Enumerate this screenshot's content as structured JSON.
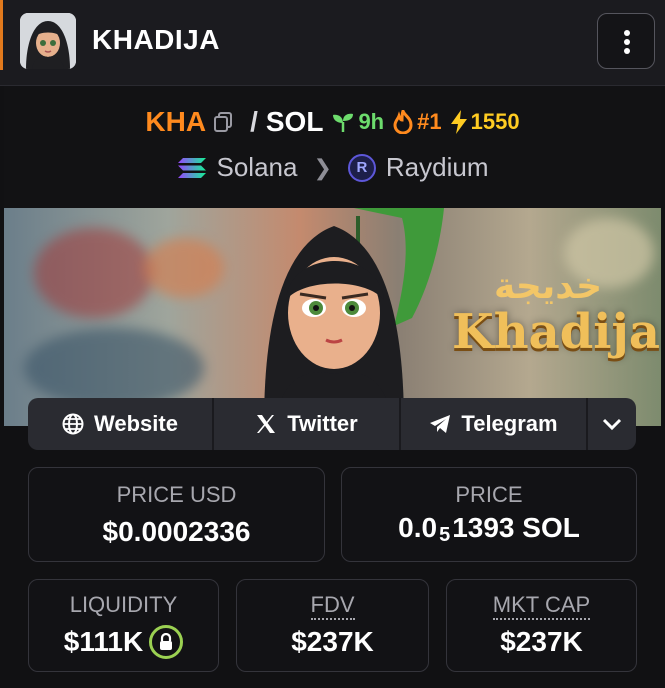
{
  "header": {
    "token_name": "KHADIJA"
  },
  "pair": {
    "base_symbol": "KHA",
    "separator": "/",
    "quote_symbol": "SOL",
    "age": "9h",
    "rank": "#1",
    "boosts": "1550",
    "chain": "Solana",
    "dex": "Raydium",
    "dex_icon_letter": "R"
  },
  "banner": {
    "arabic_text": "خديجة",
    "title": "Khadija"
  },
  "links": {
    "website": "Website",
    "twitter": "Twitter",
    "telegram": "Telegram"
  },
  "stats": {
    "price_usd_label": "PRICE USD",
    "price_usd_value": "$0.0002336",
    "price_label": "PRICE",
    "price_prefix": "0.0",
    "price_subscript": "5",
    "price_suffix": "1393 SOL",
    "liquidity_label": "LIQUIDITY",
    "liquidity_value": "$111K",
    "fdv_label": "FDV",
    "fdv_value": "$237K",
    "mktcap_label": "MKT CAP",
    "mktcap_value": "$237K"
  },
  "colors": {
    "accent_orange": "#ff8a1e",
    "age_green": "#6ddc6d",
    "boost_yellow": "#ffcc22",
    "lock_green": "#9bd152"
  },
  "icons": [
    "kebab-menu-icon",
    "copy-icon",
    "sprout-icon",
    "fire-icon",
    "lightning-icon",
    "solana-icon",
    "chevron-right-icon",
    "raydium-icon",
    "globe-icon",
    "x-logo-icon",
    "telegram-icon",
    "chevron-down-icon",
    "lock-icon"
  ]
}
